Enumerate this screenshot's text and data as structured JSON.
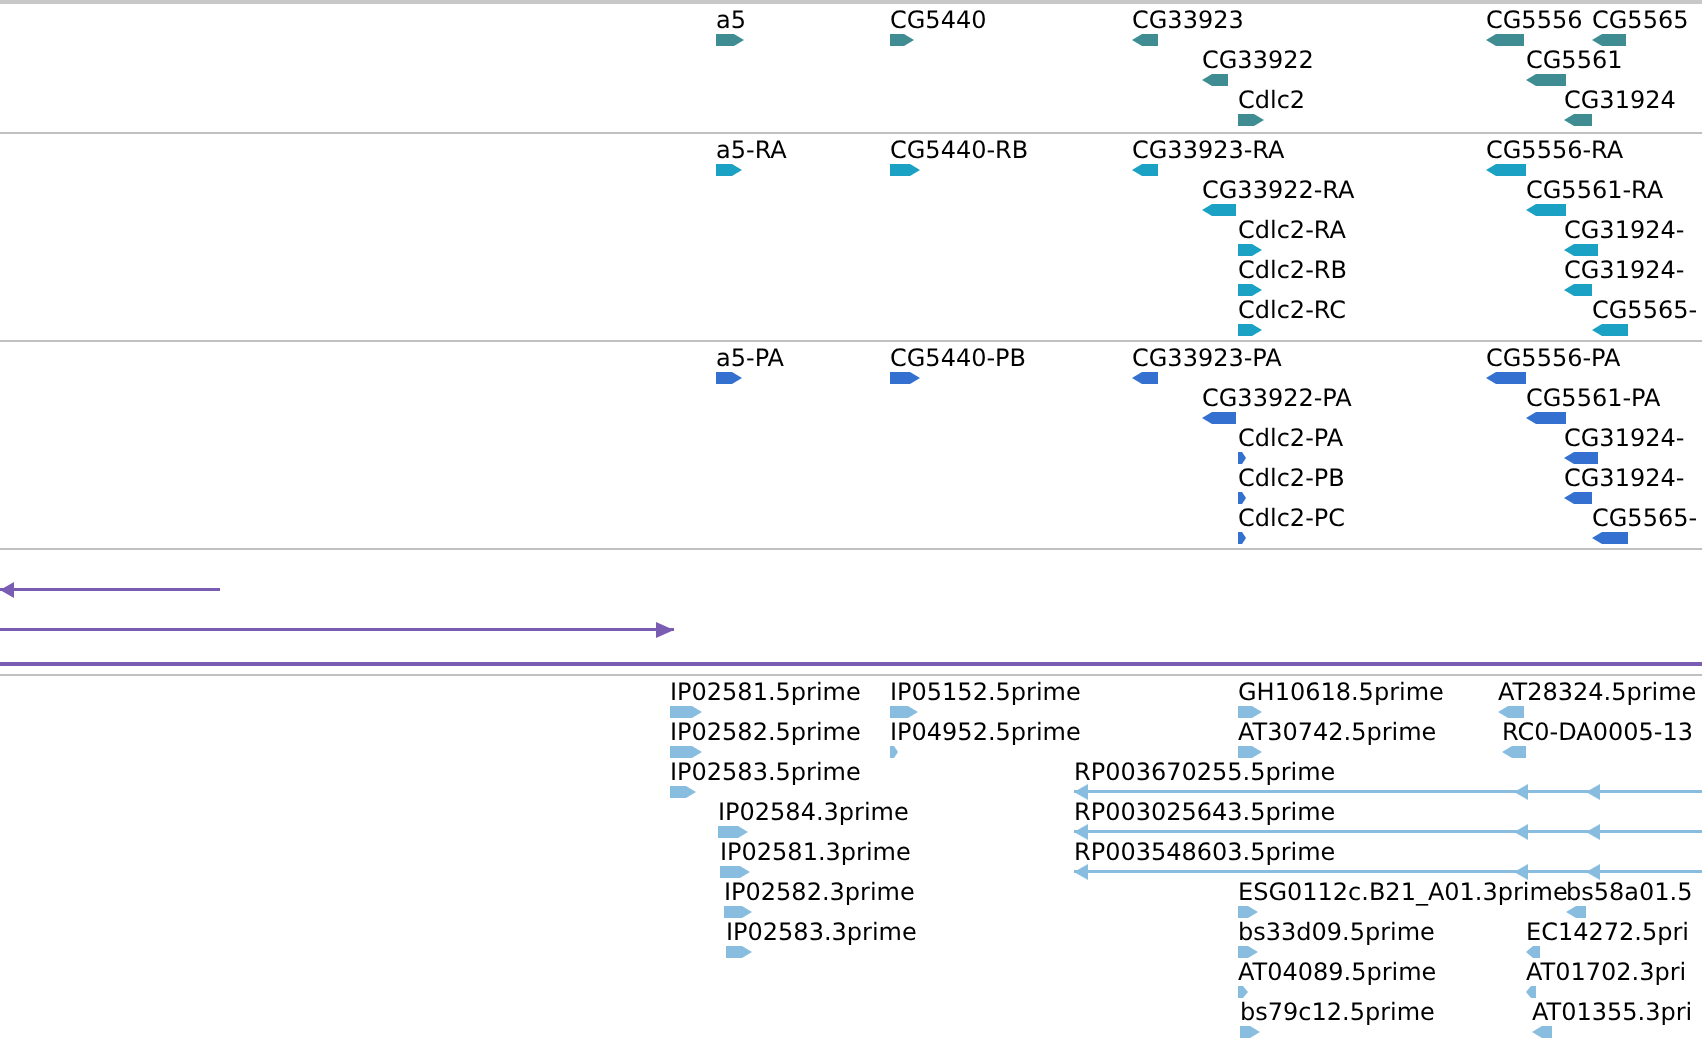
{
  "tracks": [
    {
      "color": "#3f8d92",
      "features": [
        {
          "label": "a5",
          "reverse": false
        },
        {
          "label": "CG5440",
          "reverse": false
        },
        {
          "label": "CG33923",
          "reverse": true
        },
        {
          "label": "CG5556",
          "reverse": true
        },
        {
          "label": "CG5565",
          "reverse": true
        },
        {
          "label": "CG33922",
          "reverse": true
        },
        {
          "label": "CG5561",
          "reverse": true
        },
        {
          "label": "Cdlc2",
          "reverse": false
        },
        {
          "label": "CG31924",
          "reverse": true
        }
      ]
    },
    {
      "color": "#1aa1c4",
      "features": [
        {
          "label": "a5-RA",
          "reverse": false
        },
        {
          "label": "CG5440-RB",
          "reverse": false
        },
        {
          "label": "CG33923-RA",
          "reverse": true
        },
        {
          "label": "CG5556-RA",
          "reverse": true
        },
        {
          "label": "CG33922-RA",
          "reverse": true
        },
        {
          "label": "CG5561-RA",
          "reverse": true
        },
        {
          "label": "Cdlc2-RA",
          "reverse": false
        },
        {
          "label": "CG31924-",
          "reverse": true
        },
        {
          "label": "Cdlc2-RB",
          "reverse": false
        },
        {
          "label": "CG31924-",
          "reverse": true
        },
        {
          "label": "Cdlc2-RC",
          "reverse": false
        },
        {
          "label": "CG5565-",
          "reverse": true
        }
      ]
    },
    {
      "color": "#3370d0",
      "features": [
        {
          "label": "a5-PA",
          "reverse": false
        },
        {
          "label": "CG5440-PB",
          "reverse": false
        },
        {
          "label": "CG33923-PA",
          "reverse": true
        },
        {
          "label": "CG5556-PA",
          "reverse": true
        },
        {
          "label": "CG33922-PA",
          "reverse": true
        },
        {
          "label": "CG5561-PA",
          "reverse": true
        },
        {
          "label": "Cdlc2-PA",
          "reverse": false
        },
        {
          "label": "CG31924-",
          "reverse": true
        },
        {
          "label": "Cdlc2-PB",
          "reverse": false
        },
        {
          "label": "CG31924-",
          "reverse": true
        },
        {
          "label": "Cdlc2-PC",
          "reverse": false
        },
        {
          "label": "CG5565-",
          "reverse": true
        }
      ]
    },
    {
      "color": "#7a5cb3",
      "features": [
        {
          "kind": "line",
          "reverse": true
        },
        {
          "kind": "line",
          "reverse": false
        },
        {
          "kind": "span"
        }
      ]
    },
    {
      "color": "#88bde0",
      "features": [
        {
          "label": "IP02581.5prime",
          "reverse": false
        },
        {
          "label": "IP05152.5prime",
          "reverse": false
        },
        {
          "label": "GH10618.5prime",
          "reverse": false
        },
        {
          "label": "AT28324.5prime",
          "reverse": true
        },
        {
          "label": "IP02582.5prime",
          "reverse": false
        },
        {
          "label": "IP04952.5prime",
          "reverse": false
        },
        {
          "label": "AT30742.5prime",
          "reverse": false
        },
        {
          "label": "RC0-DA0005-13",
          "reverse": true
        },
        {
          "label": "IP02583.5prime",
          "reverse": false
        },
        {
          "kind": "line",
          "label": "RP003670255.5prime",
          "reverse": true
        },
        {
          "label": "IP02584.3prime",
          "reverse": false
        },
        {
          "kind": "line",
          "label": "RP003025643.5prime",
          "reverse": true
        },
        {
          "label": "IP02581.3prime",
          "reverse": false
        },
        {
          "kind": "line",
          "label": "RP003548603.5prime",
          "reverse": true
        },
        {
          "label": "IP02582.3prime",
          "reverse": false
        },
        {
          "label": "ESG0112c.B21_A01.3prime",
          "reverse": false
        },
        {
          "label": "bs58a01.5",
          "reverse": true
        },
        {
          "label": "IP02583.3prime",
          "reverse": false
        },
        {
          "label": "bs33d09.5prime",
          "reverse": false
        },
        {
          "label": "EC14272.5pri",
          "reverse": true
        },
        {
          "label": "AT04089.5prime",
          "reverse": false
        },
        {
          "label": "AT01702.3pri",
          "reverse": true
        },
        {
          "label": "bs79c12.5prime",
          "reverse": false
        },
        {
          "label": "AT01355.3pri",
          "reverse": true
        }
      ]
    }
  ]
}
